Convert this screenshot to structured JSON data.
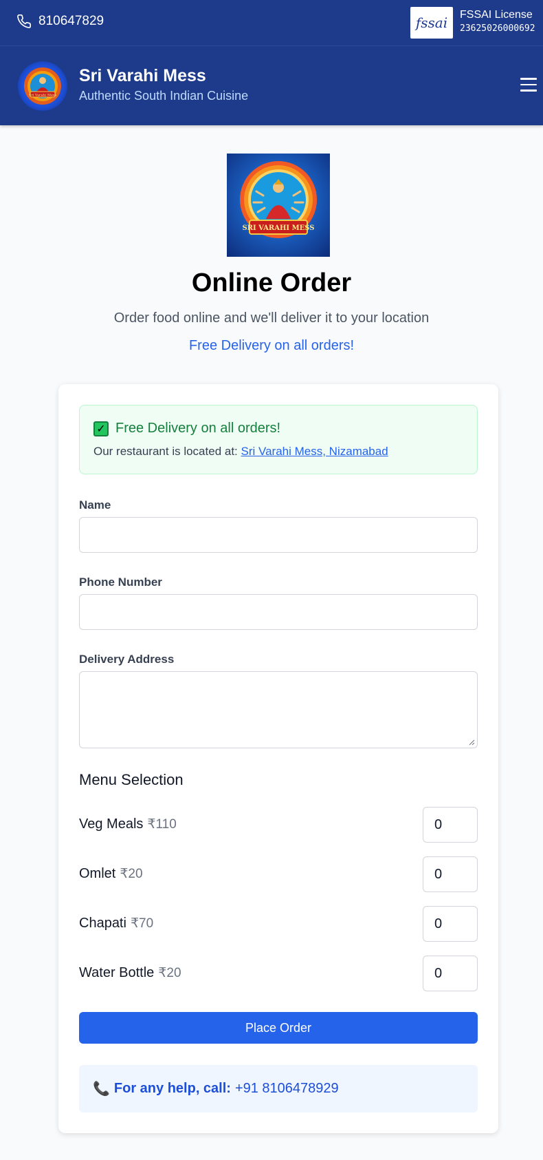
{
  "topbar": {
    "phone": "810647829",
    "fssai_logo_text": "fssai",
    "fssai_label": "FSSAI License",
    "fssai_number": "23625026000692"
  },
  "header": {
    "title": "Sri Varahi Mess",
    "subtitle": "Authentic South Indian Cuisine",
    "logo_banner": "Sri Varahi Mess"
  },
  "hero": {
    "title": "Online Order",
    "subtitle": "Order food online and we'll deliver it to your location",
    "free_delivery": "Free Delivery on all orders!",
    "logo_banner": "SRI VARAHI MESS"
  },
  "notice": {
    "heading": "Free Delivery on all orders!",
    "location_prefix": "Our restaurant is located at:",
    "location_link": "Sri Varahi Mess, Nizamabad"
  },
  "form": {
    "name_label": "Name",
    "phone_label": "Phone Number",
    "address_label": "Delivery Address",
    "name_value": "",
    "phone_value": "",
    "address_value": ""
  },
  "menu": {
    "title": "Menu Selection",
    "items": [
      {
        "name": "Veg Meals",
        "price": "₹110",
        "qty": "0"
      },
      {
        "name": "Omlet",
        "price": "₹20",
        "qty": "0"
      },
      {
        "name": "Chapati",
        "price": "₹70",
        "qty": "0"
      },
      {
        "name": "Water Bottle",
        "price": "₹20",
        "qty": "0"
      }
    ]
  },
  "actions": {
    "place_order": "Place Order"
  },
  "help": {
    "label": "For any help, call:",
    "number": "+91 8106478929"
  },
  "colors": {
    "header_bg": "#1e3a8a",
    "accent": "#2563eb",
    "success": "#15803d"
  }
}
